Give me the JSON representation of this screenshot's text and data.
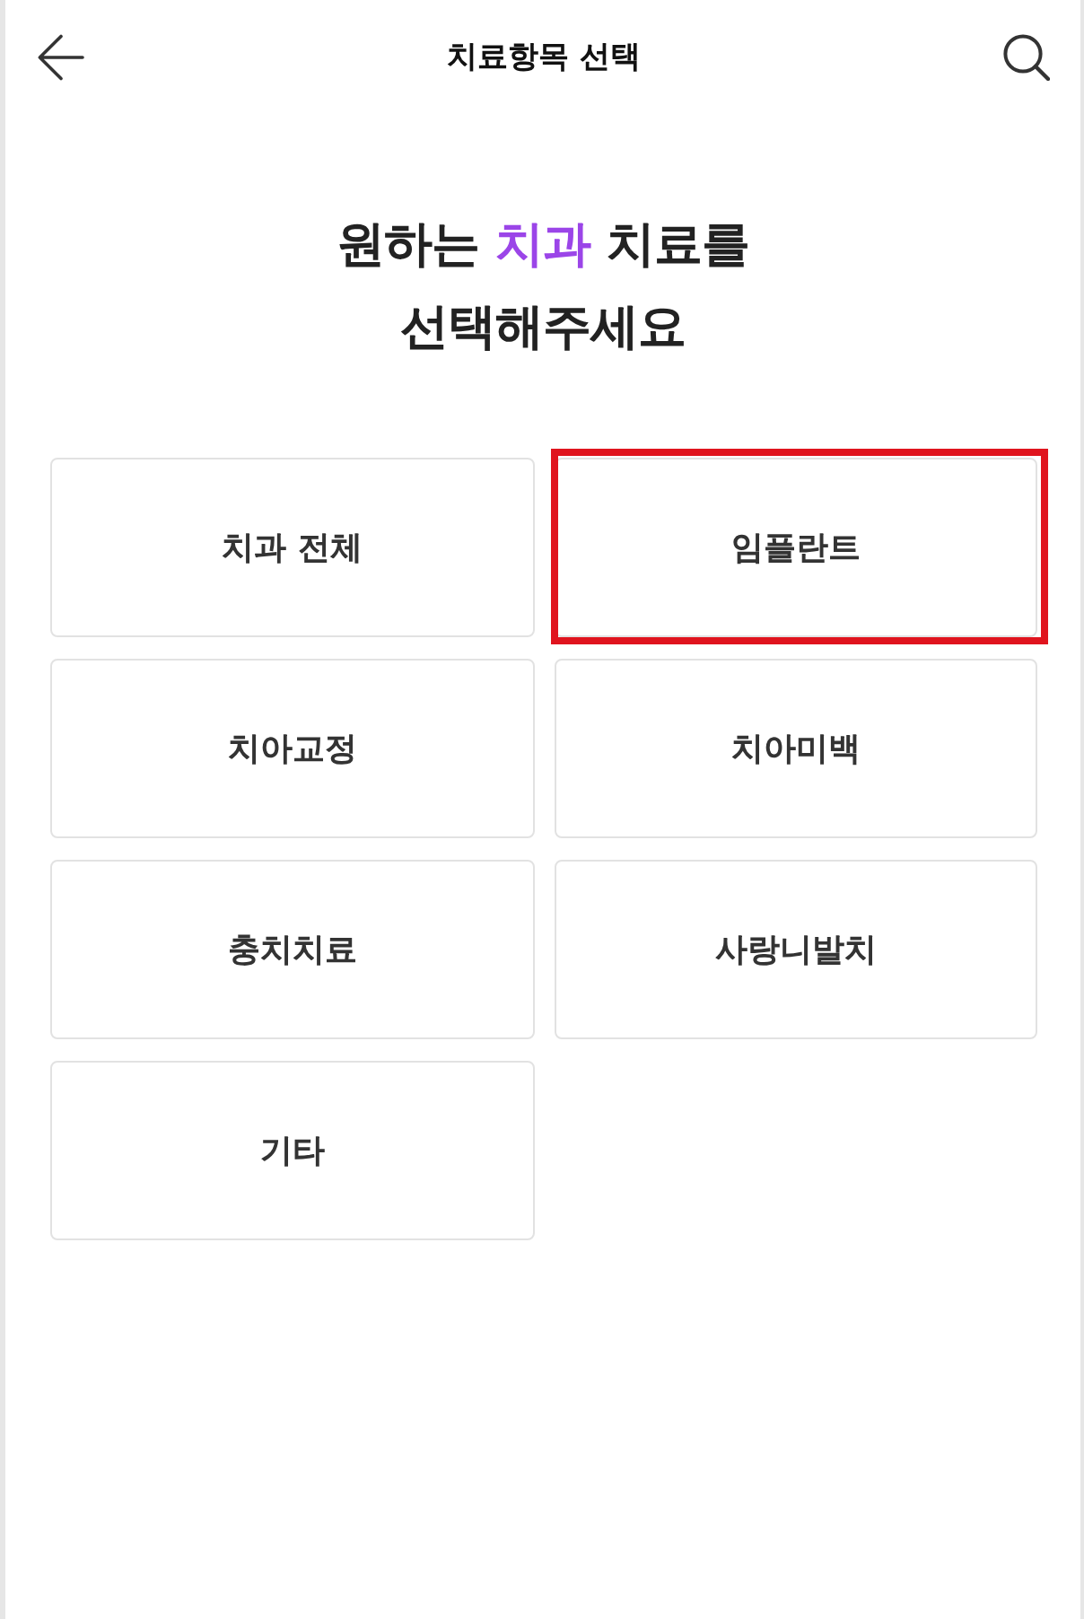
{
  "header": {
    "title": "치료항목 선택"
  },
  "heading": {
    "lines": [
      [
        {
          "text": "원하는",
          "accent": false
        },
        {
          "text": "치과",
          "accent": true
        },
        {
          "text": "치료를",
          "accent": false
        }
      ],
      [
        {
          "text": "선택해주세요",
          "accent": false
        }
      ]
    ]
  },
  "options": [
    {
      "label": "치과 전체",
      "highlighted": false
    },
    {
      "label": "임플란트",
      "highlighted": true
    },
    {
      "label": "치아교정",
      "highlighted": false
    },
    {
      "label": "치아미백",
      "highlighted": false
    },
    {
      "label": "충치치료",
      "highlighted": false
    },
    {
      "label": "사랑니발치",
      "highlighted": false
    },
    {
      "label": "기타",
      "highlighted": false
    }
  ]
}
